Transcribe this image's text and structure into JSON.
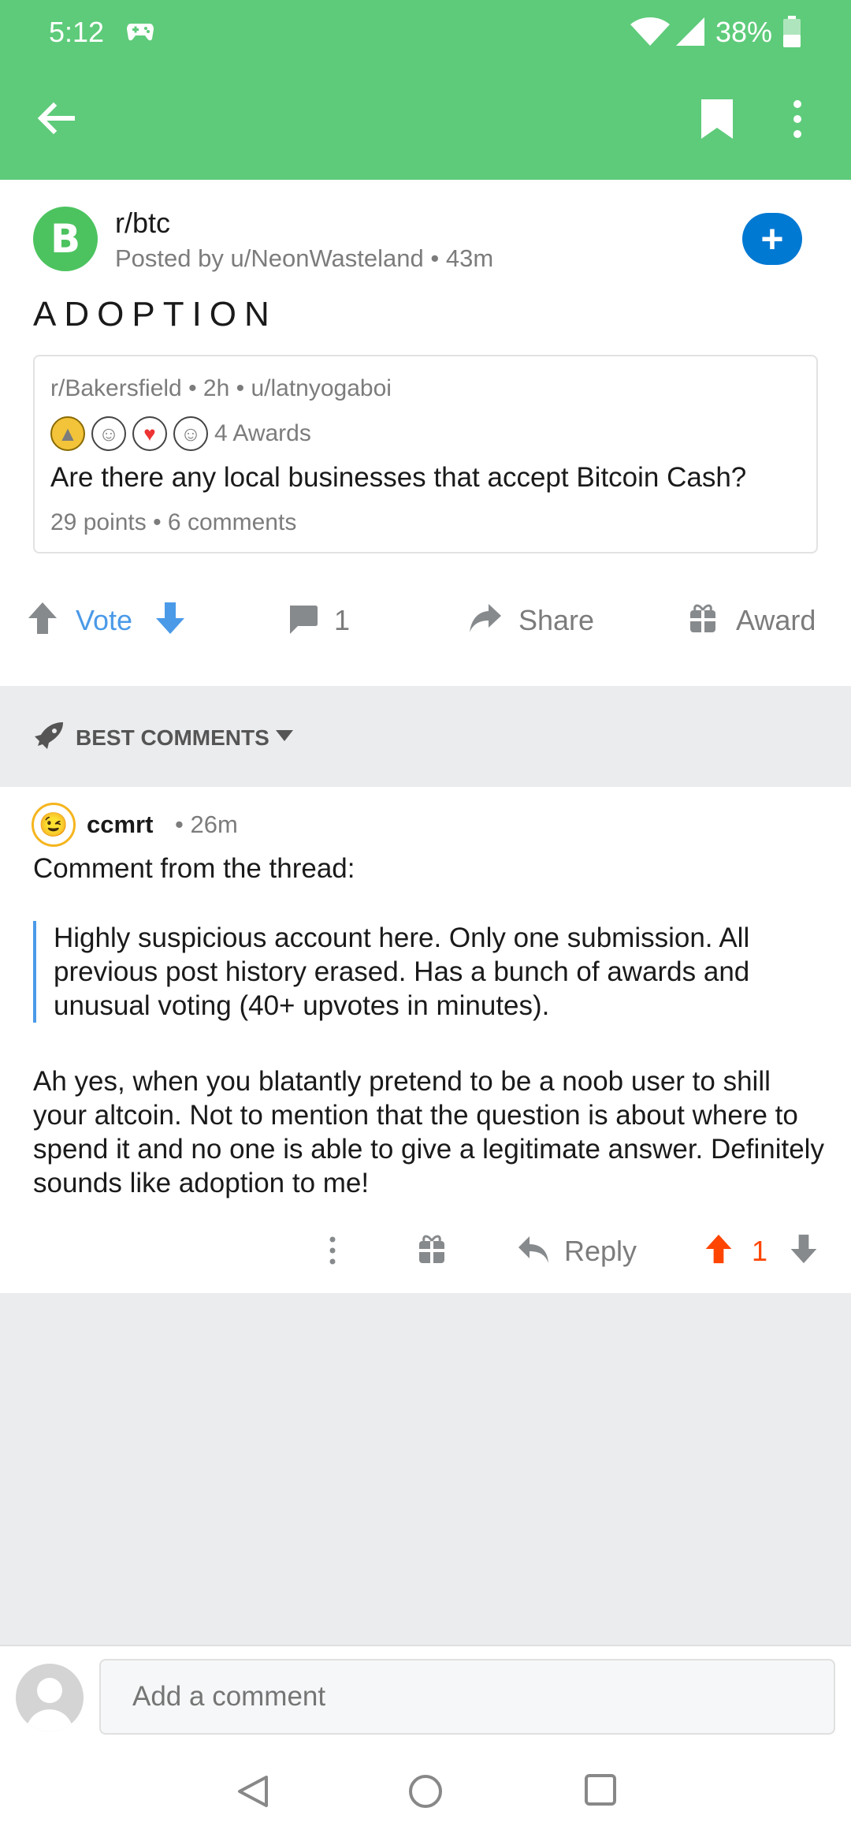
{
  "status_bar": {
    "time": "5:12",
    "battery": "38%"
  },
  "app_bar": {
    "back_icon": "arrow-left-icon",
    "bookmark_icon": "bookmark-icon",
    "more_icon": "more-vert-icon"
  },
  "post": {
    "subreddit": "r/btc",
    "posted_by": "Posted by u/NeonWasteland • 43m",
    "join_label": "+",
    "title": "ADOPTION",
    "crosspost": {
      "meta": "r/Bakersfield • 2h • u/latnyogaboi",
      "awards_label": "4 Awards",
      "title": "Are there any local businesses that accept Bitcoin Cash?",
      "stats": "29 points • 6 comments"
    },
    "actions": {
      "vote_label": "Vote",
      "comment_count": "1",
      "share_label": "Share",
      "award_label": "Award"
    }
  },
  "sort": {
    "label": "BEST COMMENTS"
  },
  "comment": {
    "user": "ccmrt",
    "time": "• 26m",
    "intro": "Comment from the thread:",
    "quote": "Highly suspicious account here. Only one submission. All previous post history erased. Has a bunch of awards and unusual voting (40+ upvotes in minutes).",
    "body": "Ah yes, when you blatantly pretend to be a noob user to shill your altcoin. Not to mention that the question is about where to spend it and no one is able to give a legitimate answer. Definitely sounds like adoption to me!",
    "reply_label": "Reply",
    "score": "1",
    "upvote_color": "#ff4500"
  },
  "composer": {
    "placeholder": "Add a comment"
  },
  "colors": {
    "brand_green": "#5ecb7a",
    "join_blue": "#0079d3",
    "vote_blue": "#4b9ae8"
  }
}
